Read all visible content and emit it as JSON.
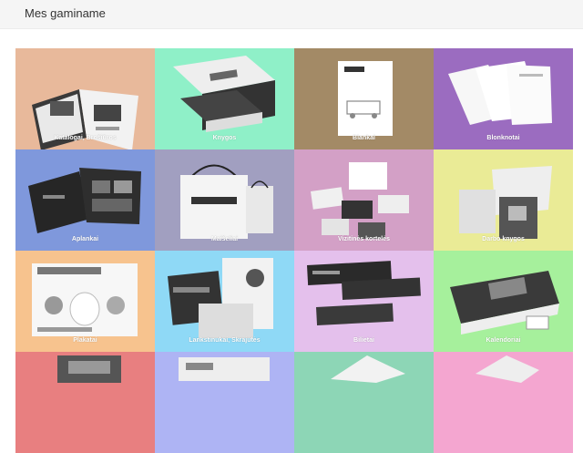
{
  "page": {
    "title": "Mes gaminame"
  },
  "products": [
    {
      "label": "Katalogai, Brošiūros",
      "color": "#e8b99b",
      "icon": "open-catalog-icon"
    },
    {
      "label": "Knygos",
      "color": "#8ff0c8",
      "icon": "book-icon"
    },
    {
      "label": "Blankai",
      "color": "#a38a66",
      "icon": "letterhead-icon"
    },
    {
      "label": "Blonknotai",
      "color": "#9b6cc0",
      "icon": "notepad-icon"
    },
    {
      "label": "Aplankai",
      "color": "#7f98dc",
      "icon": "folder-icon"
    },
    {
      "label": "Maišeliai",
      "color": "#a19fc0",
      "icon": "shopping-bag-icon"
    },
    {
      "label": "Vizitinės kortelės",
      "color": "#d3a0c6",
      "icon": "business-card-icon"
    },
    {
      "label": "Darbo knygos",
      "color": "#eaeb96",
      "icon": "workbook-icon"
    },
    {
      "label": "Plakatai",
      "color": "#f7c38e",
      "icon": "poster-icon"
    },
    {
      "label": "Lankstinukai, Skrajutės",
      "color": "#8fd9f6",
      "icon": "flyer-icon"
    },
    {
      "label": "Bilietai",
      "color": "#e4c0ec",
      "icon": "ticket-icon"
    },
    {
      "label": "Kalendoriai",
      "color": "#a6f09c",
      "icon": "calendar-icon"
    },
    {
      "label": "",
      "color": "#e87f80",
      "icon": "product-image-icon"
    },
    {
      "label": "",
      "color": "#aeb4f4",
      "icon": "product-image-icon"
    },
    {
      "label": "",
      "color": "#8dd6b6",
      "icon": "product-image-icon"
    },
    {
      "label": "",
      "color": "#f4a6d0",
      "icon": "product-image-icon"
    }
  ]
}
